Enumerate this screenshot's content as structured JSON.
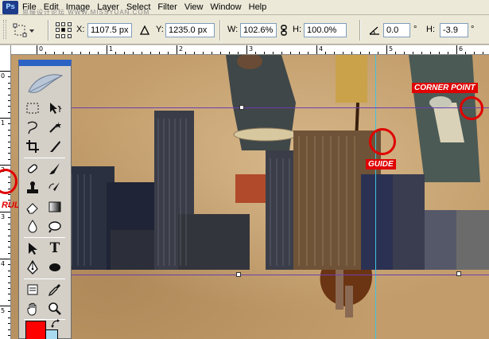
{
  "menubar": {
    "logo": "Ps",
    "items": [
      "File",
      "Edit",
      "Image",
      "Layer",
      "Select",
      "Filter",
      "View",
      "Window",
      "Help"
    ],
    "watermark": "思缘设计论坛  WWW.MISSYUAN.COM"
  },
  "options": {
    "x_label": "X:",
    "x_value": "1107.5 px",
    "y_label": "Y:",
    "y_value": "1235.0 px",
    "w_label": "W:",
    "w_value": "102.6%",
    "h_label": "H:",
    "h_value": "100.0%",
    "angle_value": "0.0",
    "angle_unit": "°",
    "hskew_label": "H:",
    "hskew_value": "-3.9",
    "hskew_unit": "°",
    "link_icon": "chain-link-icon",
    "angle_icon": "angle-icon"
  },
  "rulers": {
    "top": [
      "0",
      "1",
      "2",
      "3",
      "4",
      "5",
      "6"
    ],
    "left": [
      "0",
      "1",
      "2",
      "3",
      "4",
      "5"
    ]
  },
  "annotations": {
    "corner_point": "CORNER POINT",
    "guide": "GUIDE",
    "ruler": "RULER"
  },
  "colors": {
    "foreground": "#ff0000",
    "background": "#a9dbf0",
    "annotation": "#e00000",
    "guide": "#3cc3e5",
    "bounding_box": "#6d3fb0"
  },
  "toolbox": {
    "tools": [
      "marquee-tool",
      "move-tool",
      "lasso-tool",
      "magic-wand-tool",
      "crop-tool",
      "slice-tool",
      "healing-brush-tool",
      "brush-tool",
      "clone-stamp-tool",
      "history-brush-tool",
      "eraser-tool",
      "gradient-tool",
      "blur-tool",
      "dodge-tool",
      "path-selection-tool",
      "type-tool",
      "pen-tool",
      "shape-tool",
      "notes-tool",
      "eyedropper-tool",
      "hand-tool",
      "zoom-tool"
    ],
    "type_tool_glyph": "T"
  }
}
